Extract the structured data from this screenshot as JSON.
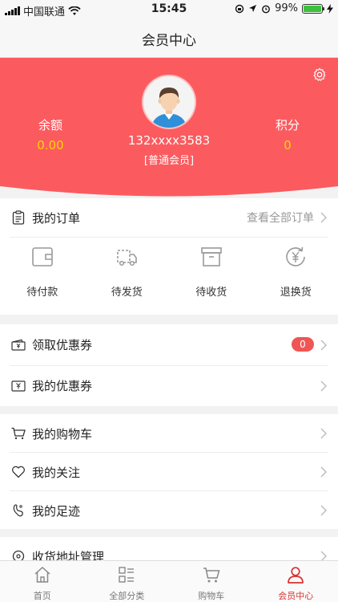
{
  "status_bar": {
    "carrier": "中国联通",
    "time": "15:45",
    "battery_percent": "99%",
    "battery_level": 0.99
  },
  "navbar": {
    "title": "会员中心"
  },
  "profile": {
    "balance_label": "余额",
    "balance_value": "0.00",
    "points_label": "积分",
    "points_value": "0",
    "phone": "132xxxx3583",
    "member_level": "[普通会员]",
    "header_color": "#fb5b5f",
    "value_color": "#ffd400"
  },
  "orders": {
    "title": "我的订单",
    "view_all": "查看全部订单",
    "items": [
      {
        "label": "待付款",
        "icon": "wallet-icon"
      },
      {
        "label": "待发货",
        "icon": "truck-icon"
      },
      {
        "label": "待收货",
        "icon": "box-icon"
      },
      {
        "label": "退换货",
        "icon": "refund-icon"
      }
    ]
  },
  "coupons": {
    "get_coupon": "领取优惠券",
    "get_coupon_count": "0",
    "my_coupons": "我的优惠券"
  },
  "menu": {
    "cart": "我的购物车",
    "follow": "我的关注",
    "footprint": "我的足迹",
    "address": "收货地址管理"
  },
  "tabbar": {
    "active_color": "#d93232",
    "items": [
      {
        "label": "首页",
        "icon": "home-icon"
      },
      {
        "label": "全部分类",
        "icon": "category-icon"
      },
      {
        "label": "购物车",
        "icon": "cart-icon"
      },
      {
        "label": "会员中心",
        "icon": "user-icon"
      }
    ]
  }
}
